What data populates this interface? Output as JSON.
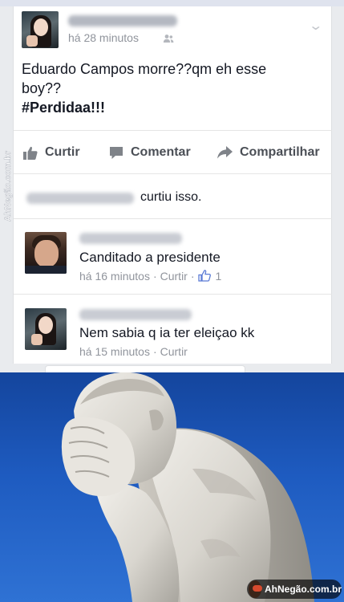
{
  "post": {
    "author_name": "Aline Fernandes",
    "timestamp": "há 28 minutos",
    "privacy_icon": "friends-icon",
    "text_line1": "Eduardo Campos morre??qm eh esse",
    "text_line2": "boy??",
    "hashtag": "#Perdidaa!!!"
  },
  "actions": {
    "like": "Curtir",
    "comment": "Comentar",
    "share": "Compartilhar"
  },
  "likes": {
    "liker_name": "Aline Fernandes",
    "text": "curtiu isso."
  },
  "comments": [
    {
      "author": "Daniel Kowalski",
      "text": "Canditado a presidente",
      "time": "há 16 minutos",
      "action": "Curtir",
      "likes": "1"
    },
    {
      "author": "Aline Fernandes",
      "text": "Nem sabia q ia ter eleiçao kk",
      "time": "há 15 minutos",
      "action": "Curtir"
    }
  ],
  "watermark": "AhNegão.com.br",
  "logo": {
    "text": "AhNegão.com.br"
  },
  "colors": {
    "facebook_gray": "#4b4f56",
    "meta_gray": "#90949c",
    "link_blue": "#3b5998",
    "sky_blue": "#1e5bc0"
  }
}
